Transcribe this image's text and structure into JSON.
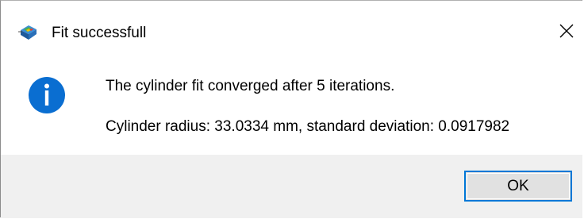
{
  "window": {
    "title": "Fit successfull",
    "app_icon": "application-cube-icon",
    "close_icon": "close-icon"
  },
  "message": {
    "icon": "info-icon",
    "line1": "The cylinder fit converged after 5 iterations.",
    "line2": "Cylinder radius: 33.0334 mm, standard deviation: 0.0917982"
  },
  "buttons": {
    "ok_label": "OK"
  },
  "colors": {
    "accent": "#0078d7",
    "footer_bg": "#f0f0f0",
    "button_bg": "#e1e1e1"
  }
}
